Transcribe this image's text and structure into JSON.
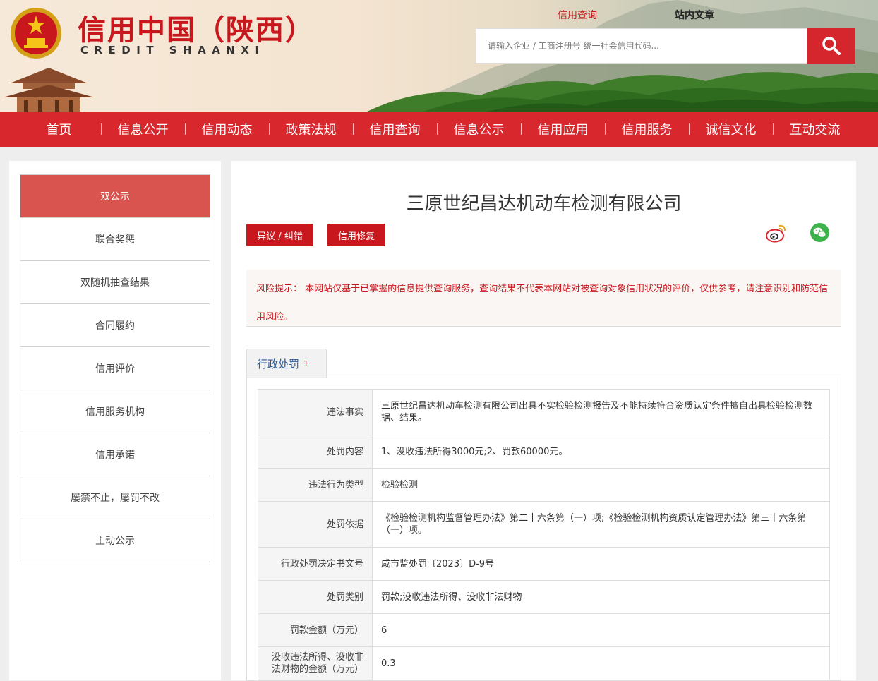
{
  "header": {
    "title": "信用中国（陕西）",
    "subtitle": "CREDIT   SHAANXI",
    "search_tabs": [
      "信用查询",
      "站内文章"
    ],
    "search_placeholder": "请输入企业 / 工商注册号 统一社会信用代码..."
  },
  "nav": [
    "首页",
    "信息公开",
    "信用动态",
    "政策法规",
    "信用查询",
    "信息公示",
    "信用应用",
    "信用服务",
    "诚信文化",
    "互动交流"
  ],
  "sidebar": {
    "items": [
      "双公示",
      "联合奖惩",
      "双随机抽查结果",
      "合同履约",
      "信用评价",
      "信用服务机构",
      "信用承诺",
      "屡禁不止，屡罚不改",
      "主动公示"
    ],
    "active_index": 0
  },
  "main": {
    "company_name": "三原世纪昌达机动车检测有限公司",
    "buttons": {
      "objection": "异议 / 纠错",
      "repair": "信用修复"
    },
    "risk_notice": "风险提示： 本网站仅基于已掌握的信息提供查询服务，查询结果不代表本网站对被查询对象信用状况的评价，仅供参考，请注意识别和防范信用风险。",
    "tab": {
      "label": "行政处罚",
      "count": "1"
    },
    "records": [
      {
        "label": "违法事实",
        "value": "三原世纪昌达机动车检测有限公司出具不实检验检测报告及不能持续符合资质认定条件擅自出具检验检测数据、结果。"
      },
      {
        "label": "处罚内容",
        "value": "1、没收违法所得3000元;2、罚款60000元。"
      },
      {
        "label": "违法行为类型",
        "value": "检验检测"
      },
      {
        "label": "处罚依据",
        "value": "《检验检测机构监督管理办法》第二十六条第（一）项;《检验检测机构资质认定管理办法》第三十六条第（一）项。"
      },
      {
        "label": "行政处罚决定书文号",
        "value": "咸市监处罚〔2023〕D-9号"
      },
      {
        "label": "处罚类别",
        "value": "罚款;没收违法所得、没收非法财物"
      },
      {
        "label": "罚款金额（万元）",
        "value": "6"
      },
      {
        "label": "没收违法所得、没收非法财物的金额（万元）",
        "value": "0.3"
      }
    ]
  },
  "colors": {
    "brand_red": "#d9272e",
    "title_red": "#c8181e",
    "sidebar_active": "#d9534f",
    "tab_blue": "#2a5a9a"
  },
  "icons": [
    "national-emblem-icon",
    "search-icon",
    "weibo-icon",
    "wechat-icon"
  ]
}
